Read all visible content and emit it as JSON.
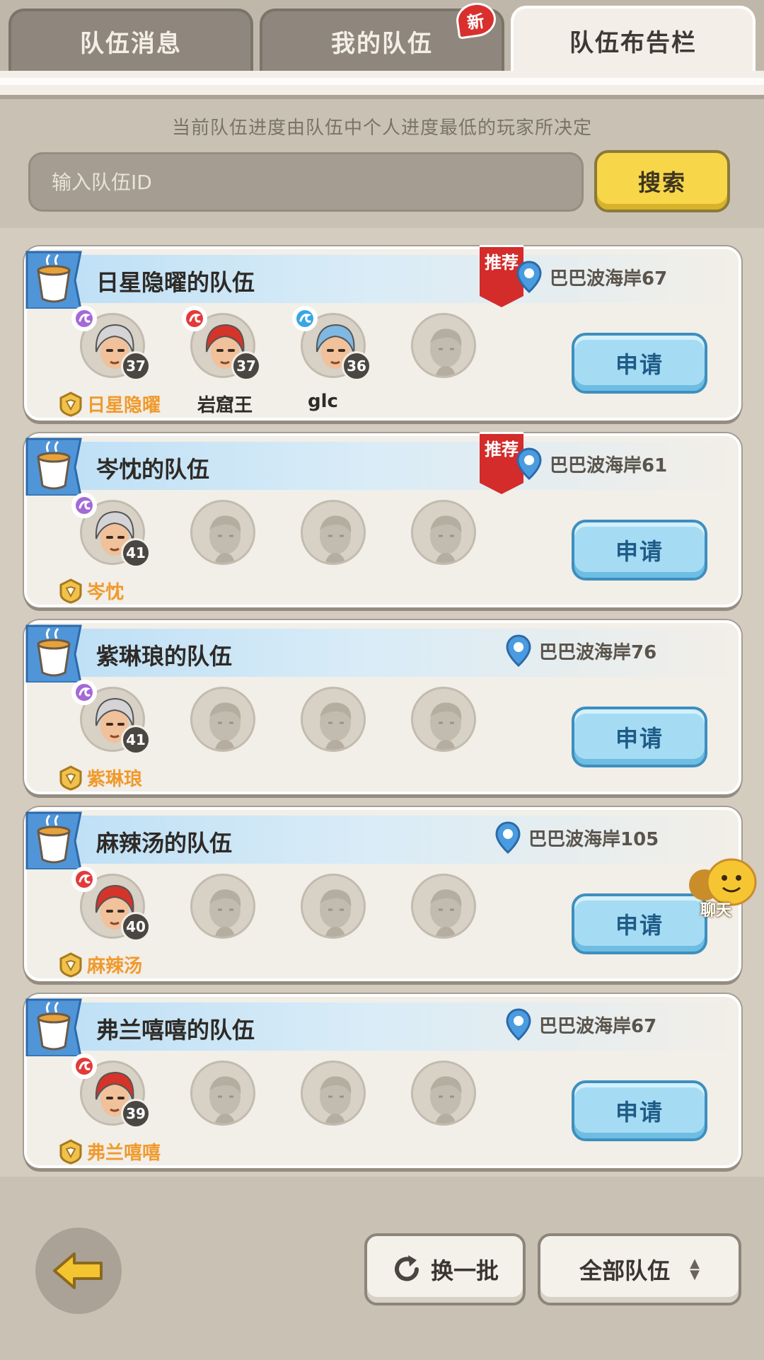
{
  "tabs": [
    {
      "label": "队伍消息",
      "active": false
    },
    {
      "label": "我的队伍",
      "active": false,
      "badge": "新"
    },
    {
      "label": "队伍布告栏",
      "active": true
    }
  ],
  "hint": "当前队伍进度由队伍中个人进度最低的玩家所决定",
  "search": {
    "placeholder": "输入队伍ID",
    "button": "搜索"
  },
  "recommend_label": "推荐",
  "apply_label": "申请",
  "chat_label": "聊天",
  "refresh_label": "换一批",
  "filter_label": "全部队伍",
  "colors": {
    "accent_blue": "#a5dcf4",
    "leader_orange": "#f09a2c",
    "search_yellow": "#f7d64a",
    "recommend_red": "#d42b2b"
  },
  "teams": [
    {
      "name": "日星隐曜的队伍",
      "recommended": true,
      "location": "巴巴波海岸67",
      "members": [
        {
          "name": "日星隐曜",
          "level": "37",
          "leader": true,
          "hair": "silver",
          "class": "purple"
        },
        {
          "name": "岩窟王",
          "level": "37",
          "leader": false,
          "hair": "red",
          "class": "red"
        },
        {
          "name": "glc",
          "level": "36",
          "leader": false,
          "hair": "blue",
          "class": "blue"
        },
        {
          "empty": true
        }
      ]
    },
    {
      "name": "岑忱的队伍",
      "recommended": true,
      "location": "巴巴波海岸61",
      "members": [
        {
          "name": "岑忱",
          "level": "41",
          "leader": true,
          "hair": "silver",
          "class": "purple"
        },
        {
          "empty": true
        },
        {
          "empty": true
        },
        {
          "empty": true
        }
      ]
    },
    {
      "name": "紫琳琅的队伍",
      "recommended": false,
      "location": "巴巴波海岸76",
      "members": [
        {
          "name": "紫琳琅",
          "level": "41",
          "leader": true,
          "hair": "silver",
          "class": "purple"
        },
        {
          "empty": true
        },
        {
          "empty": true
        },
        {
          "empty": true
        }
      ]
    },
    {
      "name": "麻辣汤的队伍",
      "recommended": false,
      "location": "巴巴波海岸105",
      "members": [
        {
          "name": "麻辣汤",
          "level": "40",
          "leader": true,
          "hair": "red",
          "class": "red"
        },
        {
          "empty": true
        },
        {
          "empty": true
        },
        {
          "empty": true
        }
      ]
    },
    {
      "name": "弗兰嘻嘻的队伍",
      "recommended": false,
      "location": "巴巴波海岸67",
      "members": [
        {
          "name": "弗兰嘻嘻",
          "level": "39",
          "leader": true,
          "hair": "red",
          "class": "red"
        },
        {
          "empty": true
        },
        {
          "empty": true
        },
        {
          "empty": true
        }
      ]
    }
  ]
}
